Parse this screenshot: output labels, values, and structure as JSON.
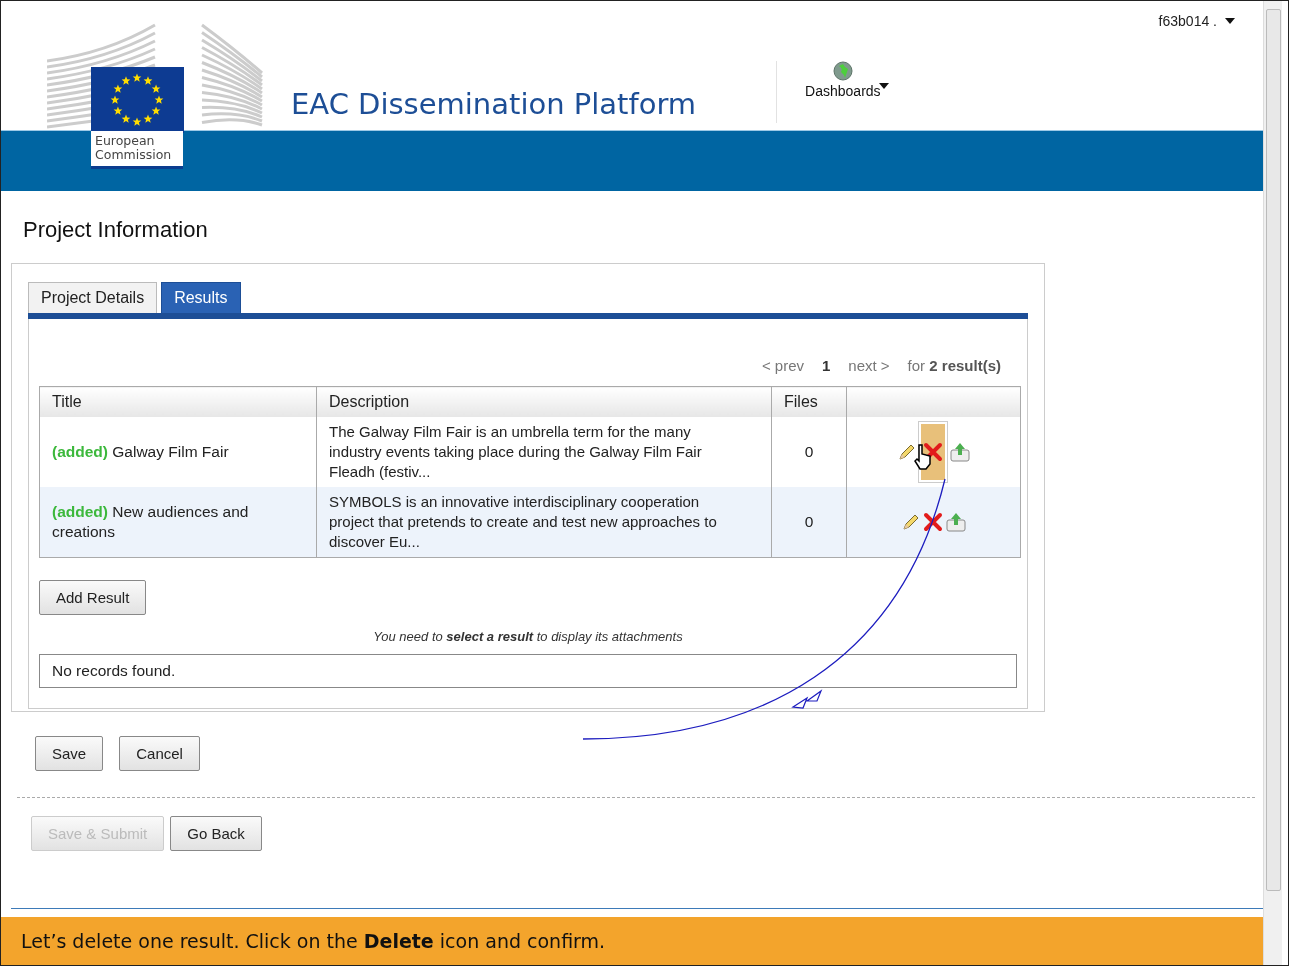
{
  "header": {
    "user_menu": "f63b014 .",
    "logo_lines": [
      "European",
      "Commission"
    ],
    "title": "EAC Dissemination Platform",
    "nav_label": "Dashboards"
  },
  "page_title": "Project Information",
  "tabs": [
    {
      "label": "Project Details",
      "selected": false
    },
    {
      "label": "Results",
      "selected": true
    }
  ],
  "pagination": {
    "prev": "< prev",
    "page": "1",
    "next": "next >",
    "total": "for **2 result(s)**"
  },
  "table": {
    "columns": [
      "Title",
      "Description",
      "Files"
    ],
    "rows": [
      {
        "tag": "(added)",
        "title": "Galway Film Fair",
        "description": "The Galway Film Fair is an umbrella term for the many industry events taking place during the Galway Film Fair Fleadh (festiv...",
        "files": "0",
        "delete_hovered": true
      },
      {
        "tag": "(added)",
        "title": "New audiences and creations",
        "description": "SYMBOLS is an innovative interdisciplinary cooperation project that pretends to create and test new approaches to discover Eu...",
        "files": "0",
        "delete_hovered": false
      }
    ]
  },
  "add_button": "Add Result",
  "hint": "You need to **select a result** to display its attachments",
  "attachments_empty": "No records found.",
  "form_buttons": [
    {
      "label": "Save",
      "disabled": false
    },
    {
      "label": "Cancel",
      "disabled": false
    }
  ],
  "footer_buttons": [
    {
      "label": "Save & Submit",
      "disabled": true
    },
    {
      "label": "Go Back",
      "disabled": false
    }
  ],
  "tutorial": "Let’s delete one result. Click on the **Delete** icon and confirm."
}
